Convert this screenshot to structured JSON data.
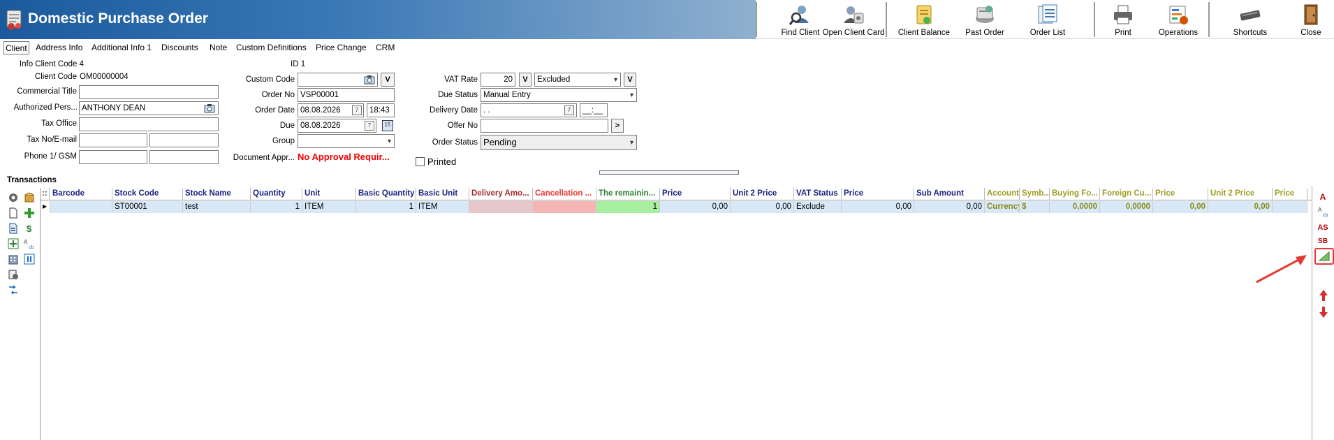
{
  "window": {
    "title": "Domestic Purchase Order"
  },
  "toolbar": {
    "buttons": [
      {
        "label": "Find Client",
        "icon": "find-client-icon"
      },
      {
        "label": "Open Client Card",
        "icon": "client-card-icon"
      },
      {
        "label": "Client Balance",
        "icon": "client-balance-icon"
      },
      {
        "label": "Past Order",
        "icon": "past-order-icon"
      },
      {
        "label": "Order List",
        "icon": "order-list-icon"
      },
      {
        "label": "Print",
        "icon": "printer-icon"
      },
      {
        "label": "Operations",
        "icon": "operations-icon"
      },
      {
        "label": "Shortcuts",
        "icon": "keyboard-icon"
      },
      {
        "label": "Close",
        "icon": "door-exit-icon"
      }
    ]
  },
  "tabs": [
    "Client",
    "Address Info",
    "Additional Info 1",
    "Discounts",
    "Note",
    "Custom Definitions",
    "Price Change",
    "CRM"
  ],
  "client": {
    "info_client_code_label": "Info Client Code",
    "info_client_code": "4",
    "client_code_label": "Client Code",
    "client_code": "OM00000004",
    "commercial_title_label": "Commercial Title",
    "commercial_title": "",
    "authorized_person_label": "Authorized Pers...",
    "authorized_person": "ANTHONY DEAN",
    "tax_office_label": "Tax Office",
    "tax_office": "",
    "tax_no_label": "Tax No/E-mail",
    "tax_no": "",
    "email": "",
    "phone_label": "Phone 1/ GSM",
    "phone": "",
    "gsm": ""
  },
  "order": {
    "id_label": "ID",
    "id": "1",
    "custom_code_label": "Custom Code",
    "custom_code": "",
    "order_no_label": "Order No",
    "order_no": "VSP00001",
    "order_date_label": "Order Date",
    "order_date": "08.08.2026",
    "order_time": "18:43",
    "due_label": "Due",
    "due": "08.08.2026",
    "group_label": "Group",
    "group": "",
    "doc_approval_label": "Document Appr...",
    "doc_approval": "No Approval Requir..."
  },
  "vat": {
    "vat_rate_label": "VAT Rate",
    "vat_rate": "20",
    "vat_mode": "Excluded",
    "v_button": "V",
    "due_status_label": "Due Status",
    "due_status": "Manual Entry",
    "delivery_date_label": "Delivery Date",
    "delivery_date": ". .",
    "delivery_time": "__:__",
    "offer_no_label": "Offer No",
    "offer_no": "",
    "offer_go": ">",
    "order_status_label": "Order Status",
    "order_status": "Pending",
    "printed_label": "Printed"
  },
  "transactions": {
    "title": "Transactions",
    "columns": [
      {
        "label": "Barcode",
        "color": "#1a237e"
      },
      {
        "label": "Stock Code",
        "color": "#1a237e"
      },
      {
        "label": "Stock Name",
        "color": "#1a237e"
      },
      {
        "label": "Quantity",
        "color": "#1a237e"
      },
      {
        "label": "Unit",
        "color": "#1a237e"
      },
      {
        "label": "Basic Quantity",
        "color": "#1a237e"
      },
      {
        "label": "Basic Unit",
        "color": "#1a237e"
      },
      {
        "label": "Delivery Amo...",
        "color": "#a52a2a"
      },
      {
        "label": "Cancellation ...",
        "color": "#e53935"
      },
      {
        "label": "The remainin...",
        "color": "#2e7d32"
      },
      {
        "label": "Price",
        "color": "#1a237e"
      },
      {
        "label": "Unit 2 Price",
        "color": "#1a237e"
      },
      {
        "label": "VAT Status",
        "color": "#1a237e"
      },
      {
        "label": "Price",
        "color": "#1a237e"
      },
      {
        "label": "Sub Amount",
        "color": "#1a237e"
      },
      {
        "label": "Account",
        "color": "#9e9d24"
      },
      {
        "label": "Symb...",
        "color": "#9e9d24"
      },
      {
        "label": "Buying Fo...",
        "color": "#9e9d24"
      },
      {
        "label": "Foreign Cu...",
        "color": "#9e9d24"
      },
      {
        "label": "Price",
        "color": "#9e9d24"
      },
      {
        "label": "Unit 2 Price",
        "color": "#9e9d24"
      },
      {
        "label": "Price",
        "color": "#9e9d24"
      }
    ],
    "rows": [
      [
        "",
        "ST00001",
        "test",
        "1",
        "ITEM",
        "1",
        "ITEM",
        "",
        "",
        "1",
        "0,00",
        "0,00",
        "Exclude",
        "0,00",
        "0,00",
        "Currency",
        "$",
        "0,0000",
        "0,0000",
        "0,00",
        "0,00",
        ""
      ]
    ]
  },
  "right_panel": {
    "buttons": [
      "A",
      "AS",
      "SB"
    ]
  },
  "colors": {
    "title_bar": "#1b5a9c",
    "row_highlight": "#d8e8f6",
    "delivery_cell": "#e6c8cc",
    "cancel_cell": "#f5b5b5",
    "remaining_cell": "#a6f0a0",
    "annotation": "#e53935"
  }
}
